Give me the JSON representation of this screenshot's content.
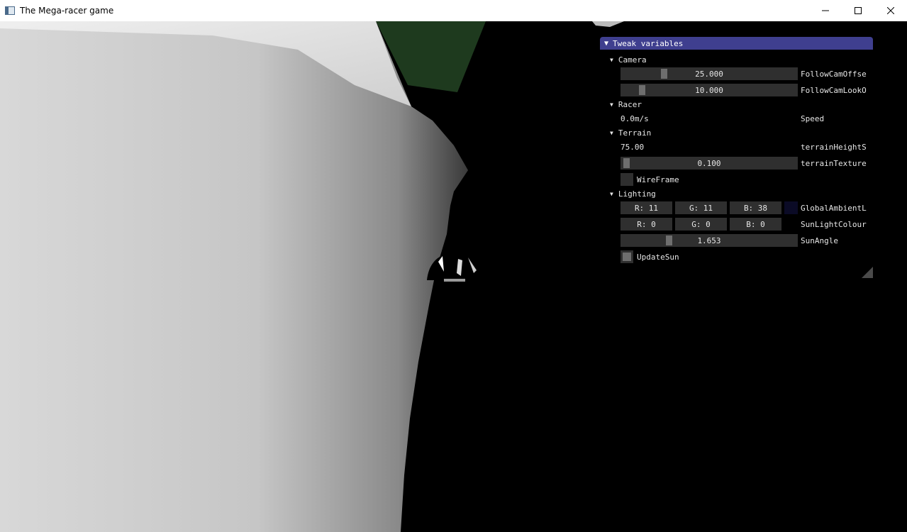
{
  "window": {
    "title": "The Mega-racer game",
    "icon": "app-window-icon",
    "controls": [
      "minimize-icon",
      "maximize-icon",
      "close-icon"
    ]
  },
  "scene": {
    "terrain_color": "#c4c4c4",
    "grass_color": "#1e3a1e",
    "sky_color": "#000000"
  },
  "panel": {
    "title": "Tweak variables",
    "header_color": "#3f3f8f",
    "sections": {
      "camera": {
        "label": "Camera",
        "follow_cam_offset": {
          "value": "25.000",
          "label": "FollowCamOffse"
        },
        "follow_cam_look": {
          "value": "10.000",
          "label": "FollowCamLookO"
        }
      },
      "racer": {
        "label": "Racer",
        "speed": {
          "value": "0.0m/s",
          "label": "Speed"
        }
      },
      "terrain": {
        "label": "Terrain",
        "height_scale": {
          "value": "75.00",
          "label": "terrainHeightS"
        },
        "texture_scale": {
          "value": "0.100",
          "label": "terrainTexture"
        },
        "wireframe": {
          "label": "WireFrame",
          "checked": false
        }
      },
      "lighting": {
        "label": "Lighting",
        "global_ambient": {
          "r": "R: 11",
          "g": "G: 11",
          "b": "B: 38",
          "swatch": "#0b0b26",
          "label": "GlobalAmbientL"
        },
        "sun_light": {
          "r": "R:  0",
          "g": "G:  0",
          "b": "B:  0",
          "swatch": "#000000",
          "label": "SunLightColour"
        },
        "sun_angle": {
          "value": "1.653",
          "label": "SunAngle"
        },
        "update_sun": {
          "label": "UpdateSun",
          "checked": true
        }
      }
    }
  }
}
